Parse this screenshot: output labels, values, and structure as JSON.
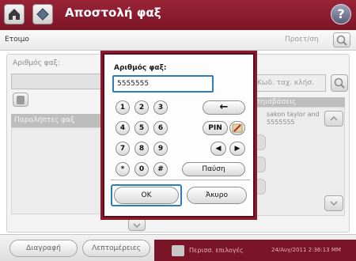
{
  "app": {
    "title": "Αποστολή φαξ",
    "help_label": "?"
  },
  "status": {
    "text": "Ετοιμο",
    "provision_label": "Προετ/ση"
  },
  "background_form": {
    "fax_number_label": "Αριθμός φαξ:",
    "speed_dial_placeholder": "Κωδ. ταχ. κλήσ.",
    "databases_label": "τηισβάσεις",
    "recipients_header": "Παραλήπτες φαξ",
    "list_entry_name": "sakon taylor and",
    "list_entry_number": "5555555"
  },
  "dialog": {
    "title": "Αριθμός φαξ:",
    "input_value": "5555555",
    "keys": [
      "1",
      "2",
      "3",
      "4",
      "5",
      "6",
      "7",
      "8",
      "9",
      "*",
      "0",
      "#"
    ],
    "backspace_label": "←",
    "pin_label": "PIN",
    "left_arrow": "◀",
    "right_arrow": "▶",
    "pause_label": "Παύση",
    "ok_label": "OK",
    "cancel_label": "Άκυρο"
  },
  "bottom": {
    "delete_label": "Διαγραφή",
    "details_label": "Λεπτομέρειες",
    "more_options_label": "Περισσ. επιλογές",
    "timestamp": "24/Αυγ/2011 2:36:13 ΜΜ"
  },
  "colors": {
    "titlebar": "#8a1a2c",
    "focus_blue": "#2a7dc0",
    "dialog_border": "#5c0c1c"
  }
}
